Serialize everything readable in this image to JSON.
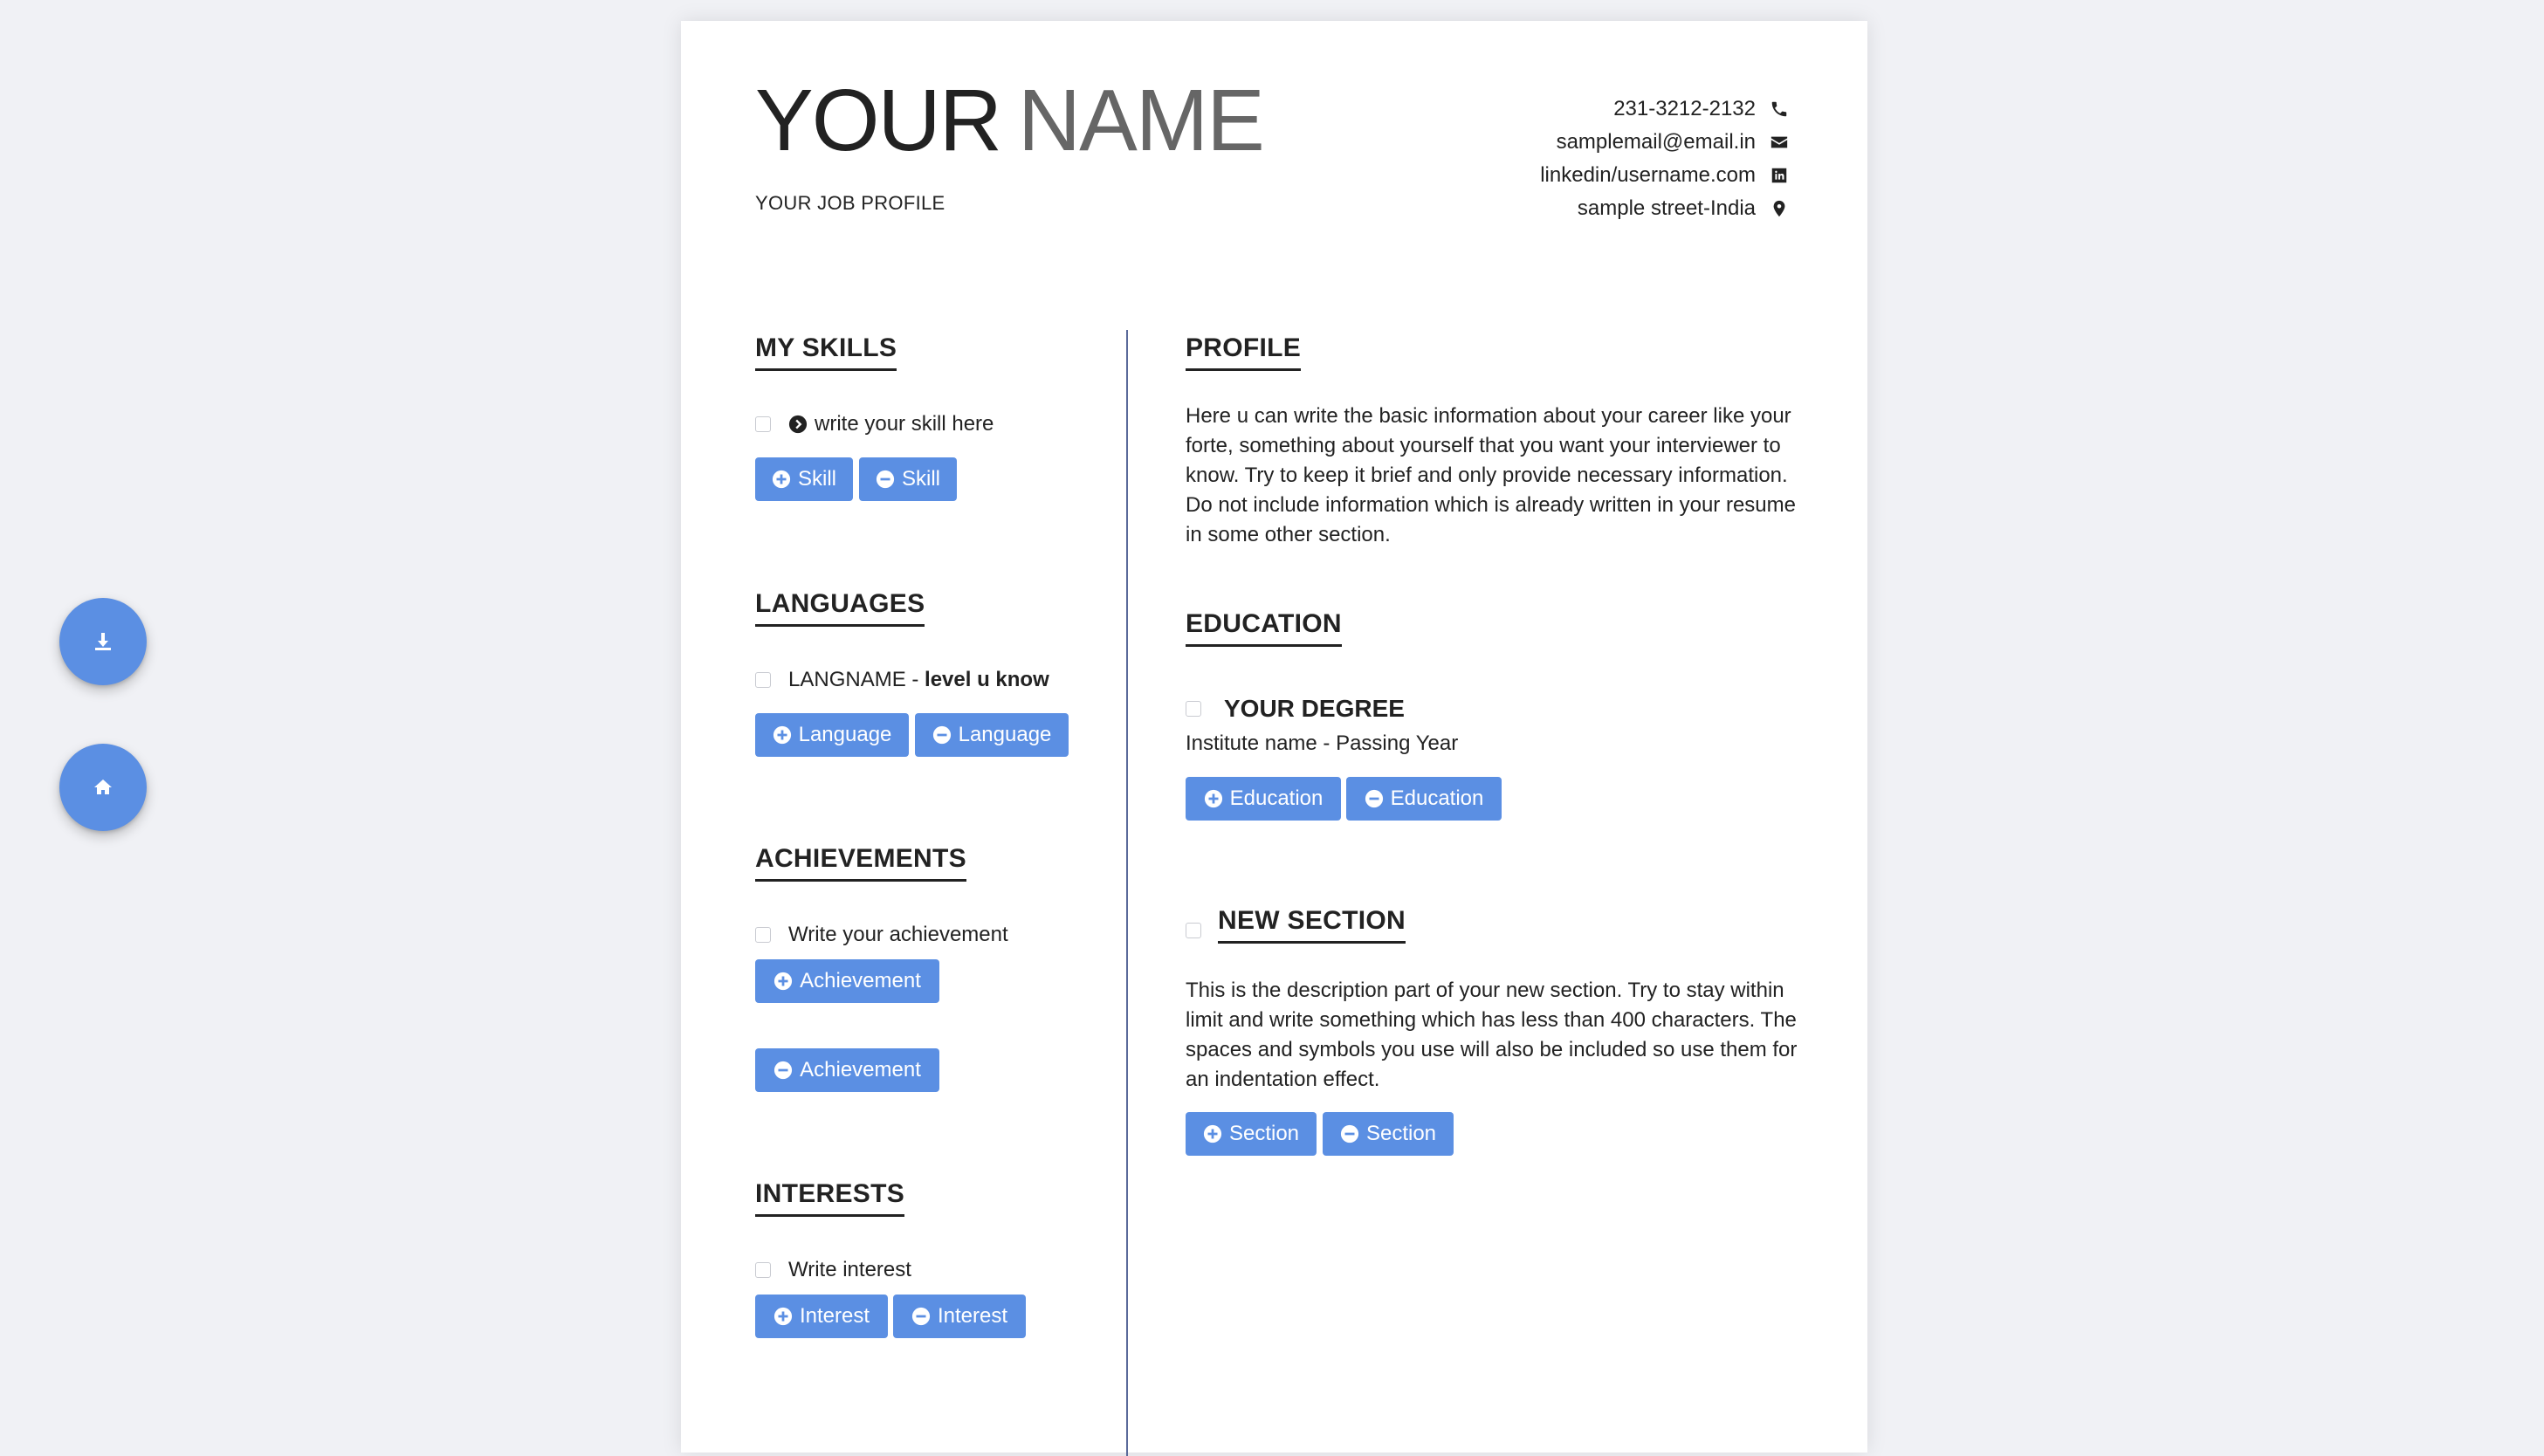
{
  "fabs": {
    "download_icon": "download-icon",
    "home_icon": "home-icon"
  },
  "header": {
    "first_name": "YOUR",
    "last_name": "NAME",
    "job_profile": "YOUR JOB PROFILE",
    "contact": {
      "phone": "231-3212-2132",
      "email": "samplemail@email.in",
      "linkedin": "linkedin/username.com",
      "address": "sample street-India"
    }
  },
  "skills": {
    "title": "MY SKILLS",
    "item": "write your skill here",
    "add_label": "Skill",
    "remove_label": "Skill"
  },
  "languages": {
    "title": "LANGUAGES",
    "item_name": "LANGNAME",
    "item_sep": " - ",
    "item_level": "level u know",
    "add_label": "Language",
    "remove_label": "Language"
  },
  "achievements": {
    "title": "ACHIEVEMENTS",
    "item": "Write your achievement",
    "add_label": "Achievement",
    "remove_label": "Achievement"
  },
  "interests": {
    "title": "INTERESTS",
    "item": "Write interest",
    "add_label": "Interest",
    "remove_label": "Interest"
  },
  "profile": {
    "title": "PROFILE",
    "text": "Here u can write the basic information about your career like your forte, something about yourself that you want your interviewer to know. Try to keep it brief and only provide necessary information. Do not include information which is already written in your resume in some other section."
  },
  "education": {
    "title": "EDUCATION",
    "degree": "YOUR DEGREE",
    "institute": "Institute name - Passing Year",
    "add_label": "Education",
    "remove_label": "Education"
  },
  "new_section": {
    "title": "NEW SECTION",
    "text": "This is the description part of your new section. Try to stay within limit and write something which has less than 400 characters. The spaces and symbols you use will also be included so use them for an indentation effect.",
    "add_label": "Section",
    "remove_label": "Section"
  },
  "colors": {
    "accent": "#5b8fe3",
    "page_bg": "#f0f1f5",
    "divider": "#5a6a9a"
  }
}
